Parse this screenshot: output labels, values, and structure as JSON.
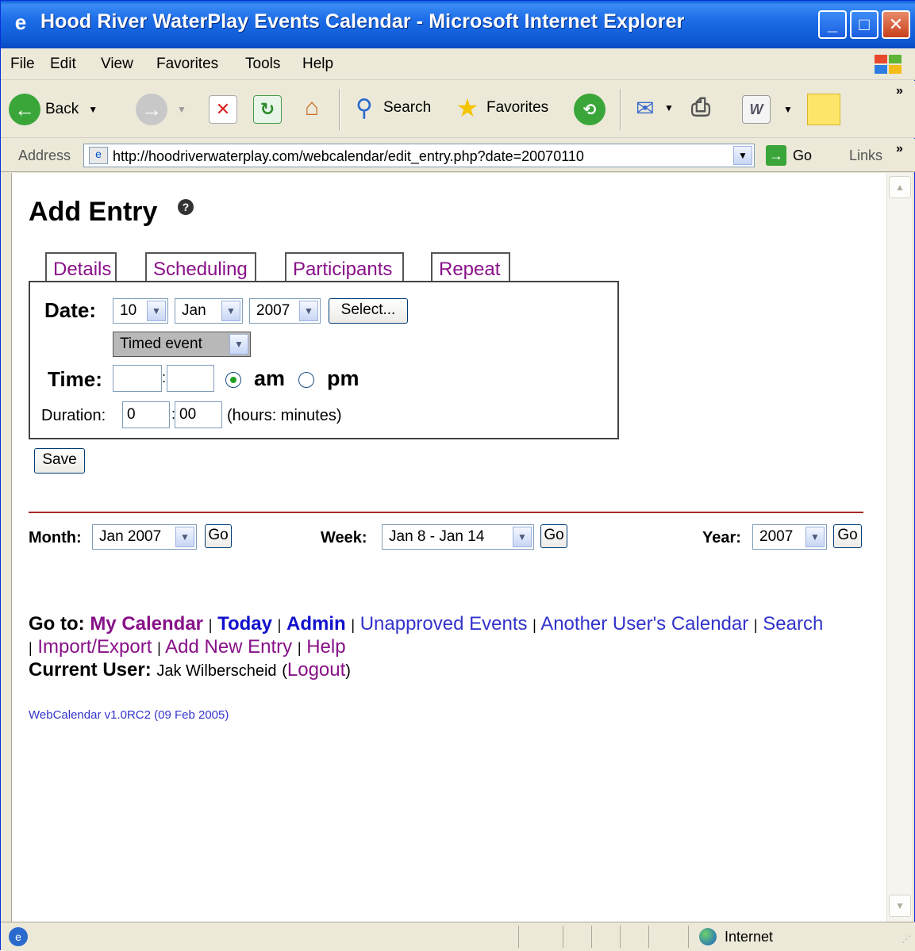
{
  "window": {
    "title": "Hood River WaterPlay Events Calendar - Microsoft Internet Explorer"
  },
  "menu": [
    "File",
    "Edit",
    "View",
    "Favorites",
    "Tools",
    "Help"
  ],
  "toolbar": {
    "back": "Back",
    "search": "Search",
    "favorites": "Favorites"
  },
  "address": {
    "label": "Address",
    "url": "http://hoodriverwaterplay.com/webcalendar/edit_entry.php?date=20070110",
    "go": "Go",
    "links": "Links"
  },
  "page": {
    "title": "Add Entry",
    "tabs": [
      "Details",
      "Scheduling",
      "Participants",
      "Repeat"
    ],
    "date_label": "Date:",
    "date_day": "10",
    "date_month": "Jan",
    "date_year": "2007",
    "select_button": "Select...",
    "event_type": "Timed event",
    "time_label": "Time:",
    "time_hour": "",
    "time_minute": "",
    "am": "am",
    "pm": "pm",
    "duration_label": "Duration:",
    "duration_hours": "0",
    "duration_minutes": "00",
    "duration_hint": "(hours: minutes)",
    "save": "Save"
  },
  "nav": {
    "month_label": "Month:",
    "month_value": "Jan 2007",
    "week_label": "Week:",
    "week_value": "Jan 8 - Jan 14",
    "year_label": "Year:",
    "year_value": "2007",
    "go": "Go"
  },
  "goto": {
    "label": "Go to:",
    "my_calendar": "My Calendar",
    "today": "Today",
    "admin": "Admin",
    "unapproved": "Unapproved Events",
    "another_user": "Another User's Calendar",
    "search": "Search",
    "import_export": "Import/Export",
    "add_new": "Add New Entry",
    "help": "Help",
    "current_user_label": "Current User:",
    "current_user": "Jak Wilberscheid",
    "logout": "Logout"
  },
  "footer": "WebCalendar v1.0RC2 (09 Feb 2005)",
  "status": {
    "zone": "Internet"
  }
}
